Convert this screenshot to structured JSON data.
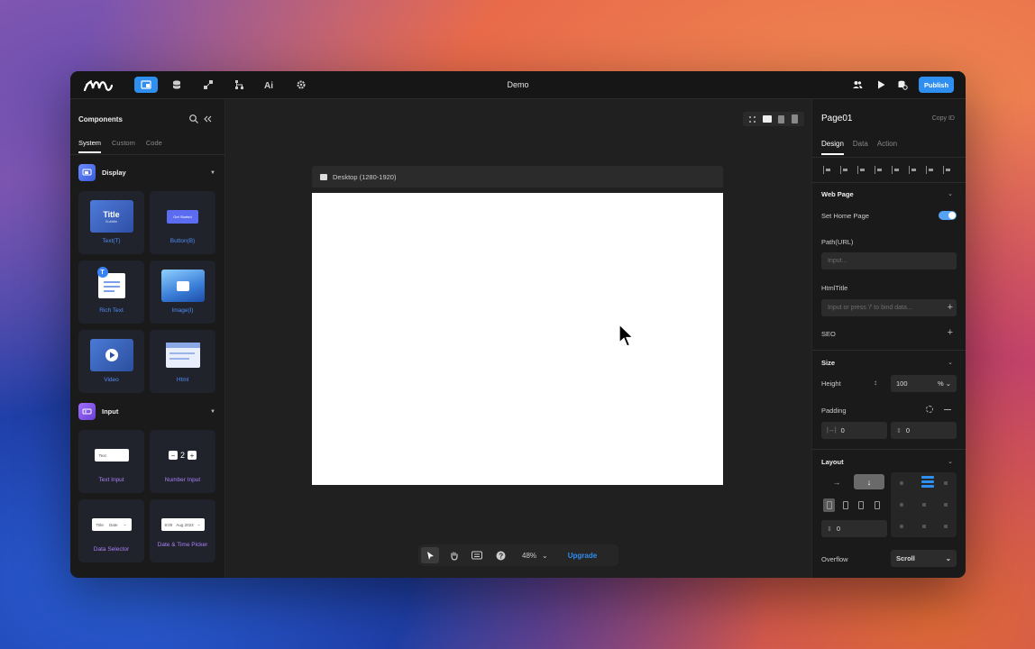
{
  "app": {
    "title": "Demo",
    "publish_label": "Publish"
  },
  "toolbar_icons": [
    "pages-icon",
    "database-icon",
    "logic-icon",
    "flow-icon",
    "ai-icon",
    "settings-icon"
  ],
  "left_panel": {
    "title": "Components",
    "tabs": [
      "System",
      "Custom",
      "Code"
    ],
    "sections": [
      {
        "label": "Display",
        "items": [
          "Text(T)",
          "Button(B)",
          "Rich Text",
          "Image(I)",
          "Video",
          "Html"
        ]
      },
      {
        "label": "Input",
        "items": [
          "Text Input",
          "Number Input",
          "Data Selector",
          "Date & Time Picker"
        ]
      }
    ],
    "thumb": {
      "title_text": "Title",
      "subtitle_text": "Subtitle",
      "button_text": "Get Started",
      "text_input_placeholder": "Text",
      "number_value": "2",
      "select_title": "Title",
      "select_option": "Date",
      "datetime_time": "8:00",
      "datetime_date": "Aug 2023"
    }
  },
  "canvas": {
    "frame_label": "Desktop (1280-1920)",
    "zoom": "48%",
    "upgrade_label": "Upgrade"
  },
  "right_panel": {
    "page_name": "Page01",
    "copy_id": "Copy ID",
    "tabs": [
      "Design",
      "Data",
      "Action"
    ],
    "web_page": {
      "heading": "Web Page",
      "set_home_label": "Set Home Page",
      "set_home_value": true,
      "path_label": "Path(URL)",
      "path_placeholder": "Input...",
      "html_title_label": "HtmlTitle",
      "html_title_placeholder": "Input or press '/' to bind data...",
      "seo_label": "SEO"
    },
    "size": {
      "heading": "Size",
      "height_label": "Height",
      "height_value": "100",
      "height_unit": "%",
      "padding_label": "Padding",
      "padding_h": "0",
      "padding_v": "0"
    },
    "layout": {
      "heading": "Layout",
      "gap_value": "0",
      "overflow_label": "Overflow",
      "overflow_value": "Scroll"
    }
  }
}
